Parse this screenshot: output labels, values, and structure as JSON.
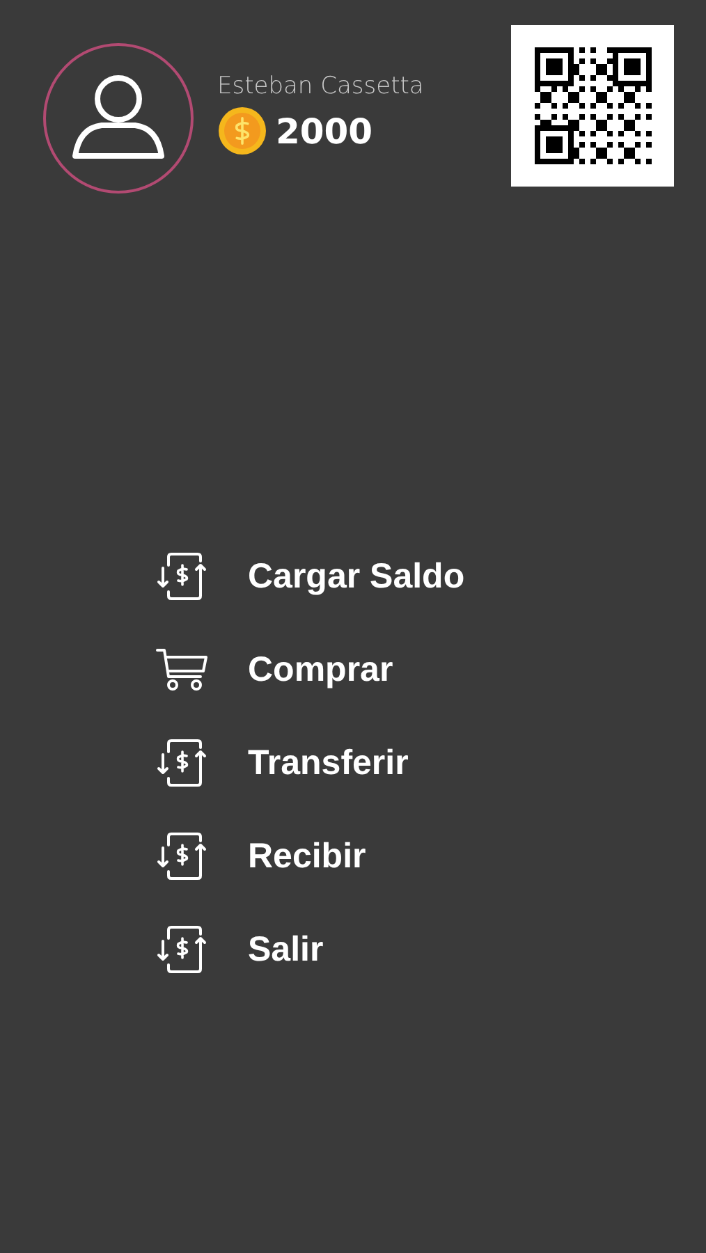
{
  "profile": {
    "name": "Esteban Cassetta",
    "balance": "2000"
  },
  "menu": [
    {
      "label": "Cargar Saldo",
      "kind": "transfer"
    },
    {
      "label": "Comprar",
      "kind": "cart"
    },
    {
      "label": "Transferir",
      "kind": "transfer"
    },
    {
      "label": "Recibir",
      "kind": "transfer"
    },
    {
      "label": "Salir",
      "kind": "transfer"
    }
  ]
}
